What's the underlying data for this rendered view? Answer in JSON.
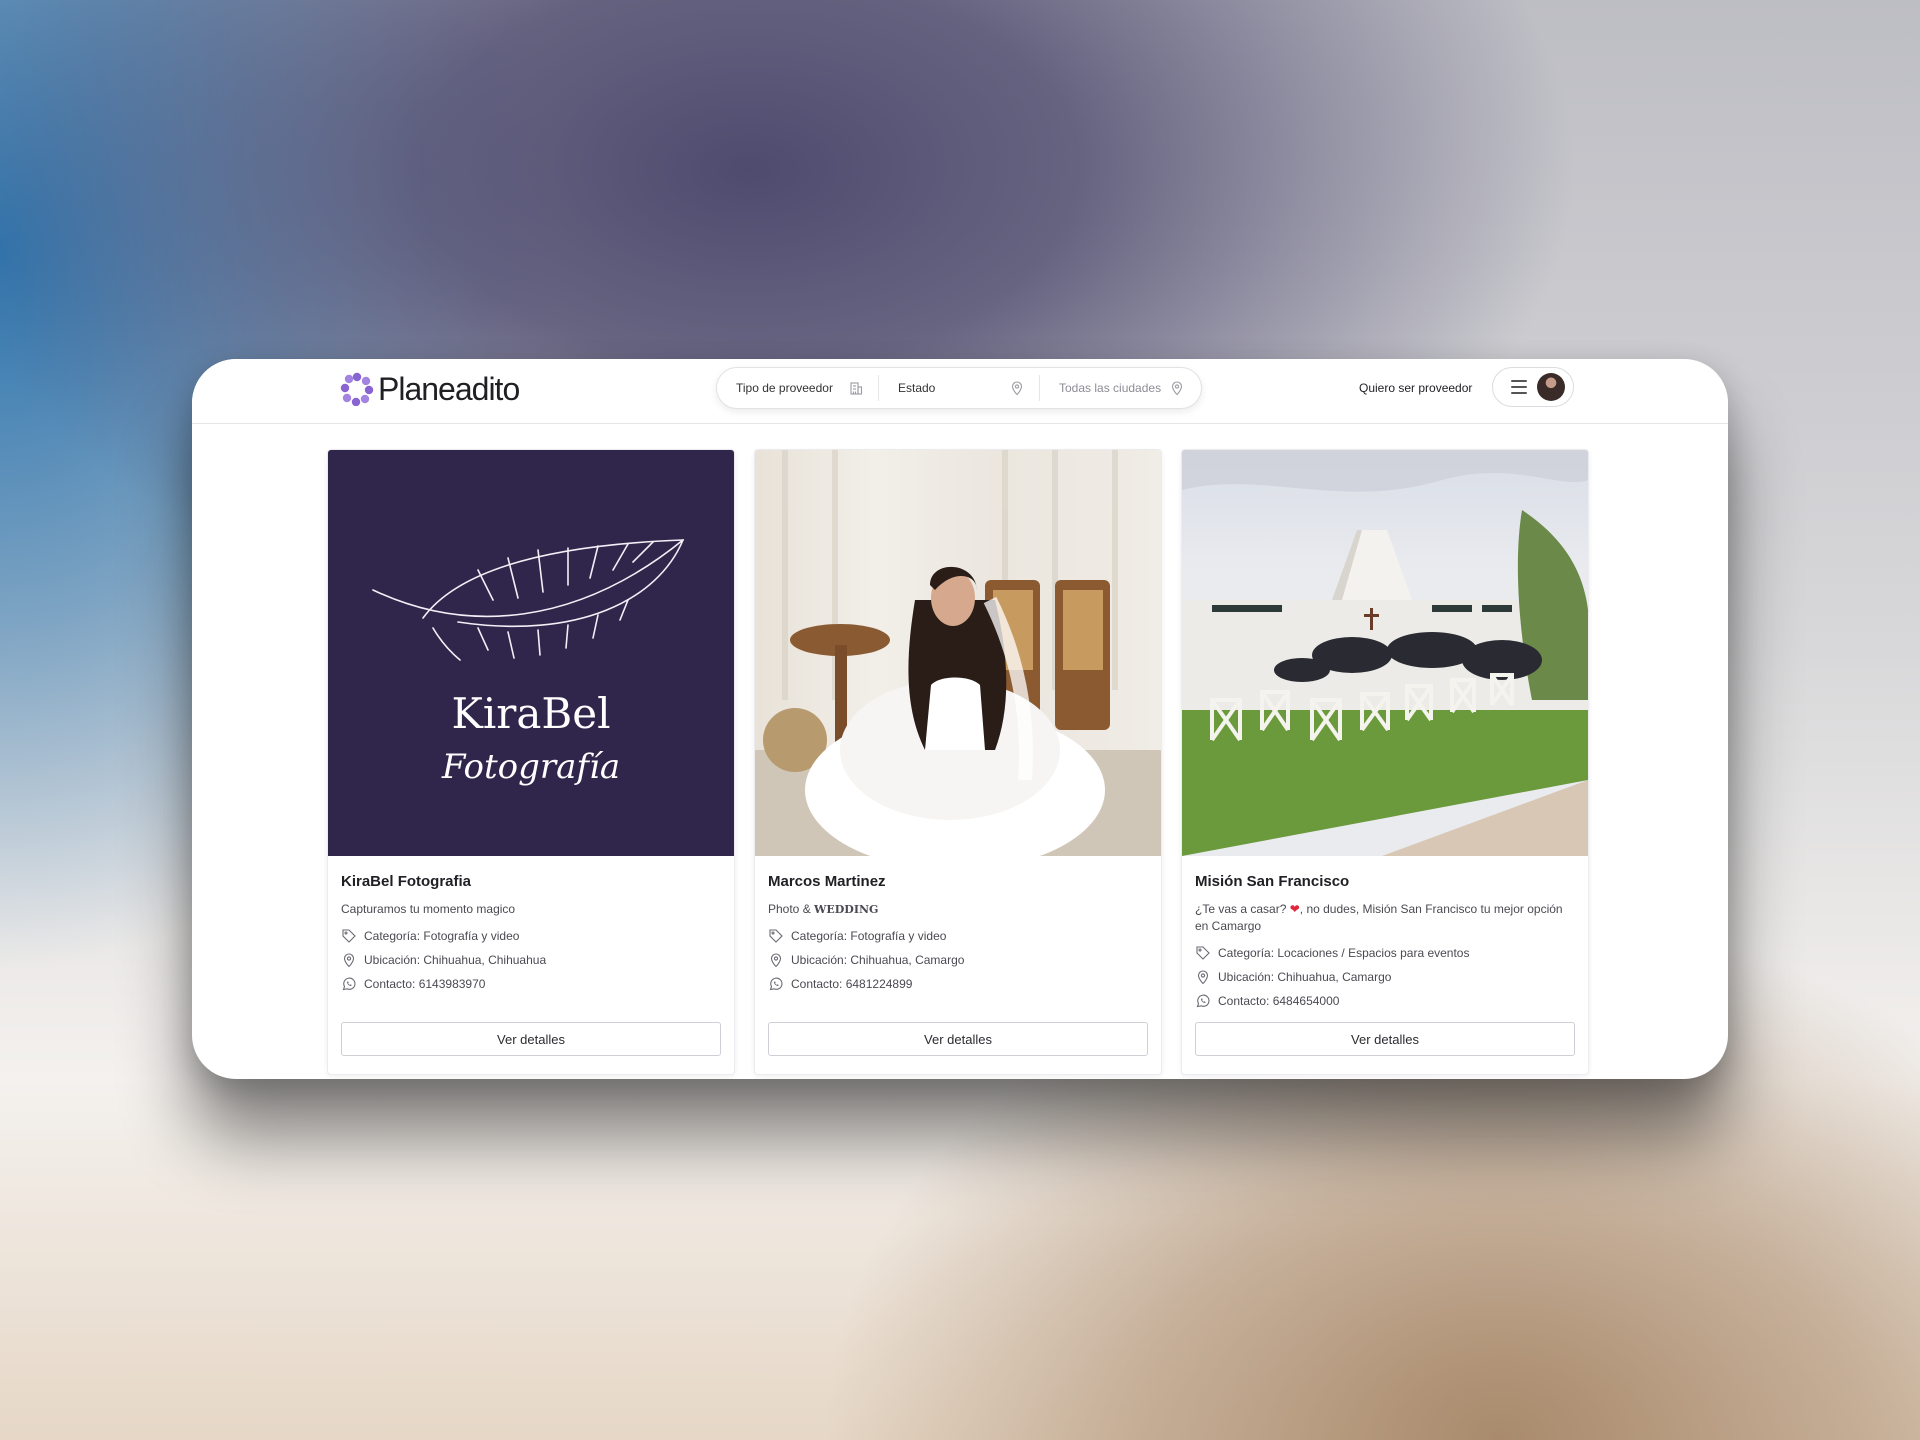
{
  "brand": {
    "name": "Planeadito",
    "accent": "#8a63d2"
  },
  "search": {
    "provider_type": "Tipo de proveedor",
    "state": "Estado",
    "cities": "Todas las ciudades"
  },
  "header": {
    "become_provider": "Quiero ser proveedor"
  },
  "cards": [
    {
      "title": "KiraBel Fotografia",
      "description": "Capturamos tu momento magico",
      "category": "Categoría: Fotografía y video",
      "location": "Ubicación: Chihuahua, Chihuahua",
      "contact": "Contacto: 6143983970",
      "button": "Ver detalles",
      "image": {
        "logo_line1": "KiraBel",
        "logo_line2": "Fotografía",
        "bg": "#30264c"
      }
    },
    {
      "title": "Marcos Martinez",
      "description_part1": "Photo & ",
      "description_part2": "WEDDING",
      "category": "Categoría: Fotografía y video",
      "location": "Ubicación: Chihuahua, Camargo",
      "contact": "Contacto: 6481224899",
      "button": "Ver detalles"
    },
    {
      "title": "Misión San Francisco",
      "description_part1": "¿Te vas a casar? ",
      "description_emoji": "❤",
      "description_part2": ", no dudes, Misión San Francisco tu mejor opción en Camargo",
      "category": "Categoría: Locaciones / Espacios para eventos",
      "location": "Ubicación: Chihuahua, Camargo",
      "contact": "Contacto: 6484654000",
      "button": "Ver detalles"
    }
  ]
}
